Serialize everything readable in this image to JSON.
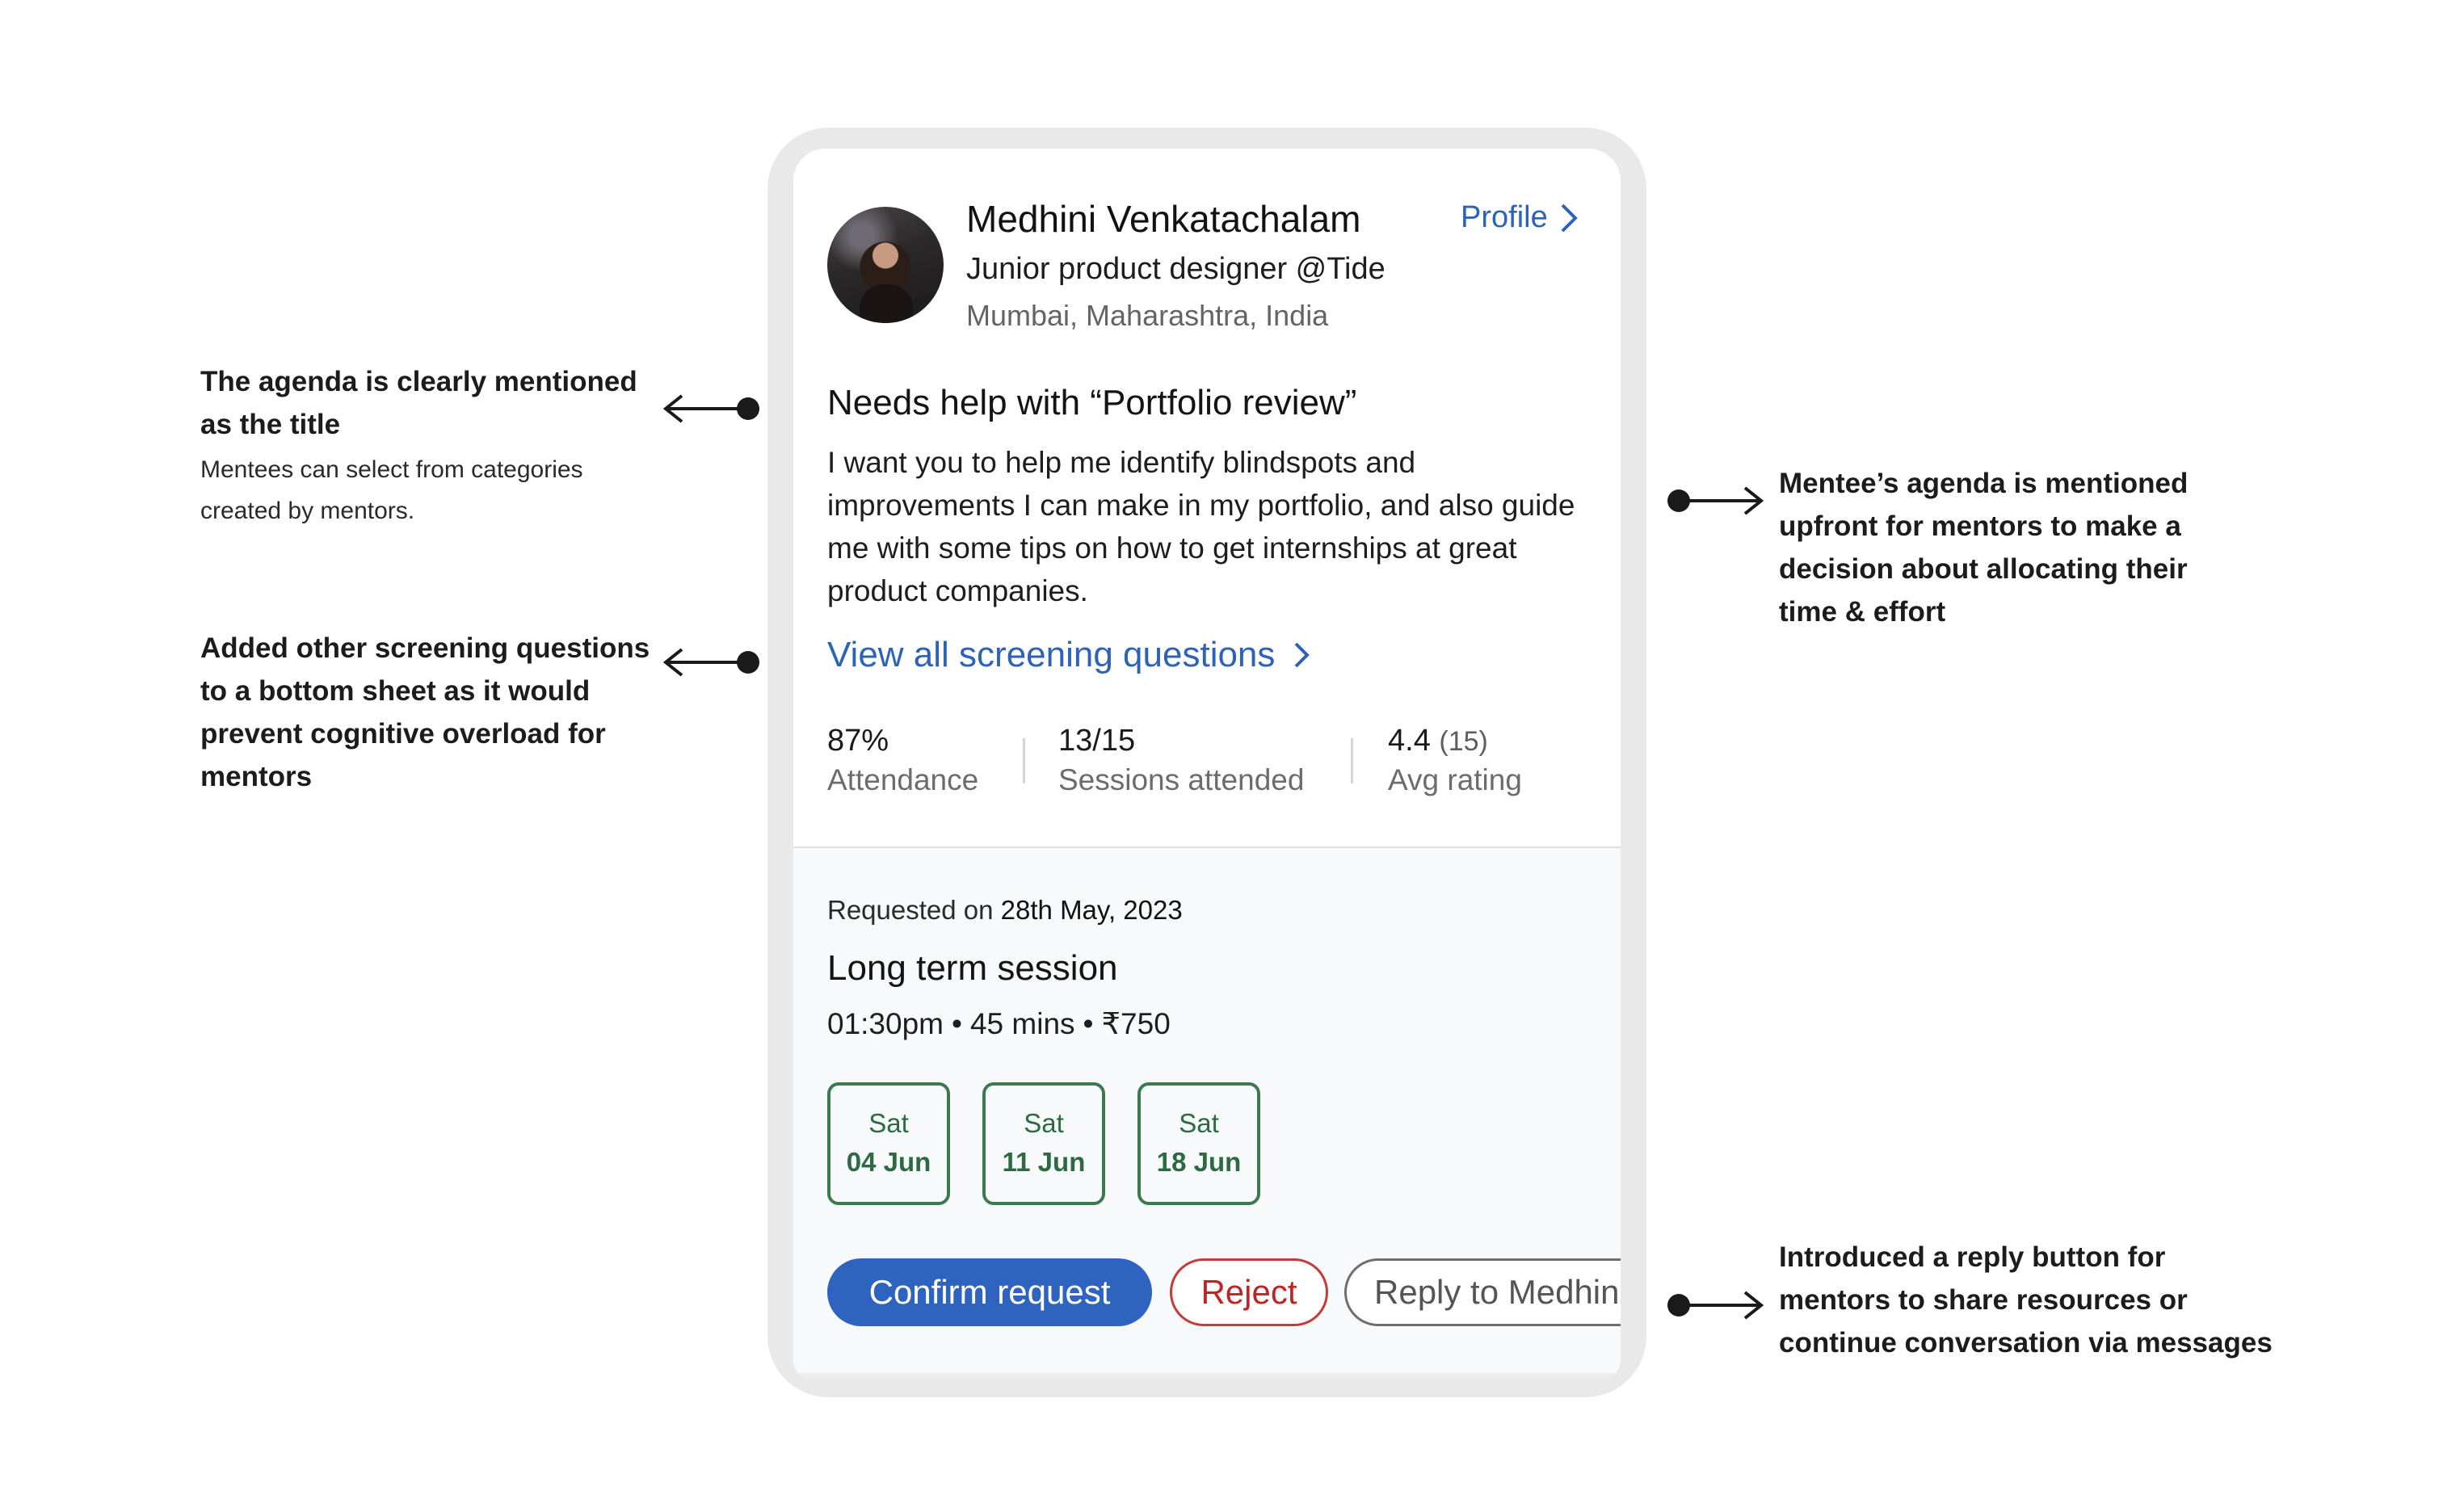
{
  "annotations": {
    "agenda_title": {
      "heading": "The agenda is clearly mentioned as the title",
      "note": "Mentees can select from categories created by mentors."
    },
    "screening": {
      "heading": "Added other screening questions to a bottom sheet as it would prevent cognitive overload for mentors"
    },
    "agenda_upfront": {
      "heading": "Mentee’s agenda is mentioned upfront for mentors to make a decision about allocating their time & effort"
    },
    "reply_button": {
      "heading": "Introduced a reply button for mentors to share resources or continue conversation via messages"
    }
  },
  "profile": {
    "name": "Medhini Venkatachalam",
    "profile_link": "Profile",
    "title": "Junior product designer @Tide",
    "location": "Mumbai, Maharashtra, India"
  },
  "request": {
    "help_title": "Needs help with “Portfolio review”",
    "help_body": "I want you to help me identify blindspots and improvements I can make in my portfolio, and also guide me with some tips on how to get internships at great product companies.",
    "view_all": "View all screening questions"
  },
  "stats": [
    {
      "value": "87%",
      "label": "Attendance"
    },
    {
      "value": "13/15",
      "label": "Sessions attended"
    },
    {
      "value": "4.4",
      "extra": "(15)",
      "label": "Avg rating"
    }
  ],
  "session": {
    "requested_prefix": "Requested on",
    "requested_date": "28th May, 2023",
    "type": "Long term session",
    "time": "01:30pm",
    "duration": "45 mins",
    "price": "₹750",
    "separator": "•",
    "dates": [
      {
        "day": "Sat",
        "date": "04 Jun"
      },
      {
        "day": "Sat",
        "date": "11 Jun"
      },
      {
        "day": "Sat",
        "date": "18 Jun"
      }
    ]
  },
  "actions": {
    "confirm": "Confirm request",
    "reject": "Reject",
    "reply": "Reply to Medhini"
  },
  "colors": {
    "link_blue": "#2c62b8",
    "confirm_blue": "#2e64c0",
    "reject_red": "#c02525",
    "chip_green": "#2d6a41"
  },
  "icons": [
    "chevron-right-icon",
    "arrow-left-icon",
    "arrow-right-icon",
    "dot-icon"
  ]
}
